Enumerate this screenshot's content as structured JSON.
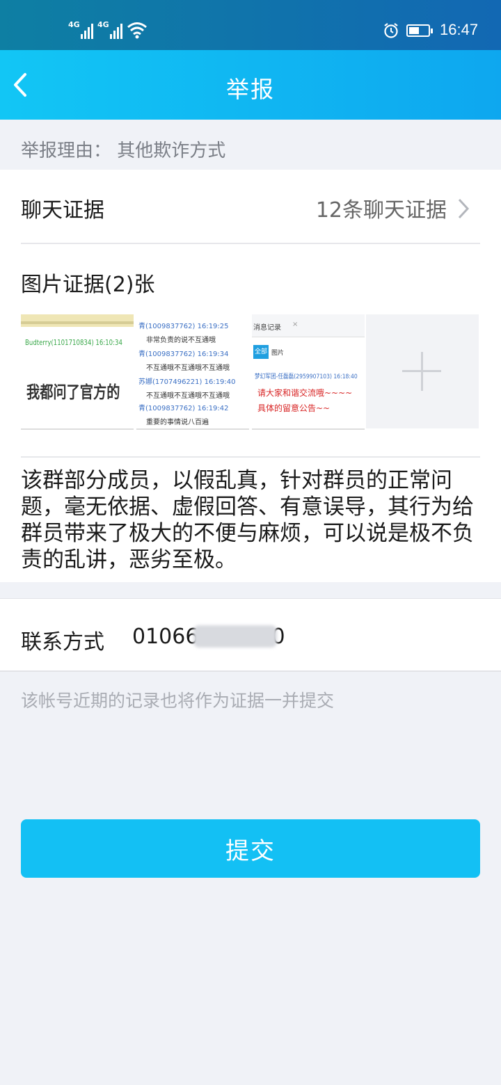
{
  "status_bar": {
    "network_1": "4G",
    "network_2": "4G",
    "time": "16:47",
    "icons": [
      "signal-icon",
      "wifi-icon",
      "alarm-icon",
      "battery-icon"
    ]
  },
  "header": {
    "title": "举报",
    "back_icon": "chevron-left-icon"
  },
  "report": {
    "reason": "举报理由：  其他欺诈方式"
  },
  "chat_evidence": {
    "label": "聊天证据",
    "value": "12条聊天证据"
  },
  "image_evidence": {
    "title": "图片证据(2)张",
    "thumb1": {
      "line1": "Budterry(1101710834) 16:10:34",
      "line2": "我都问了官方的"
    },
    "thumb2": {
      "rows": [
        {
          "name": "青(1009837762) 16:19:25",
          "msg": "非常负责的说不互通哦"
        },
        {
          "name": "青(1009837762) 16:19:34",
          "msg": "不互通哦不互通哦不互通哦"
        },
        {
          "name": "苏娜(1707496221) 16:19:40",
          "msg": "不互通哦不互通哦不互通哦"
        },
        {
          "name": "青(1009837762) 16:19:42",
          "msg": "重要的事情说八百遍"
        }
      ]
    },
    "thumb3": {
      "tab": "消息记录",
      "close": "×",
      "filter_all": "全部",
      "filter_img": "图片",
      "sender": "梦幻军团-任磊磊(2959907103) 16:18:40",
      "msg": "请大家和谐交流哦~~~~具体的留意公告~~"
    },
    "add_icon": "plus-icon"
  },
  "description": "该群部分成员，以假乱真，针对群员的正常问题，毫无依据、虚假回答、有意误导，其行为给群员带来了极大的不便与麻烦，可以说是极不负责的乱讲，恶劣至极。",
  "contact": {
    "label": "联系方式",
    "value_visible_start": "01066",
    "value_visible_end": "0"
  },
  "note": "该帐号近期的记录也将作为证据一并提交",
  "submit_label": "提交",
  "colors": {
    "status_bar": "#0e7fa3",
    "nav_bar": "#12c6f5",
    "submit": "#13c0f4",
    "background": "#f0f2f7",
    "name_blue": "#3a6fc4",
    "red_msg": "#d82525"
  }
}
